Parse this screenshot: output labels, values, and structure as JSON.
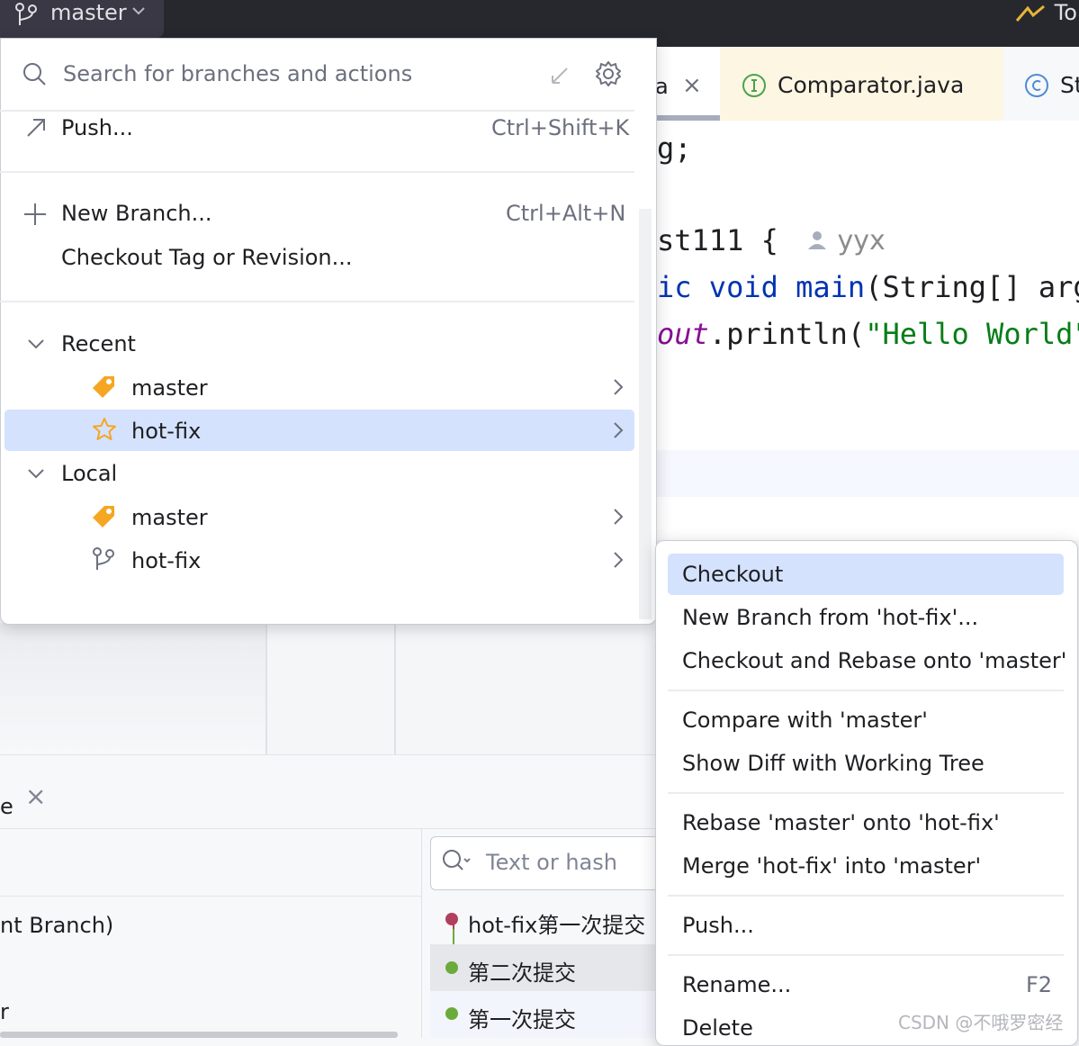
{
  "titlebar": {
    "branch_label": "master",
    "right_text": "To"
  },
  "editor_tabs": [
    {
      "label": "a",
      "close": "×"
    },
    {
      "label": "Comparator.java"
    },
    {
      "label": "St"
    }
  ],
  "code": {
    "line1": "g;",
    "line2": "st111 {",
    "author": "yyx",
    "line3_kw": "ic void ",
    "line3_fn": "main",
    "line3_rest": "(String[] arg",
    "line4_fld": "out",
    "line4_mid": ".println(",
    "line4_str": "\"Hello World\""
  },
  "branch_popup": {
    "search_placeholder": "Search for branches and actions",
    "actions": [
      {
        "label": "Push...",
        "shortcut": "Ctrl+Shift+K"
      },
      {
        "label": "New Branch...",
        "shortcut": "Ctrl+Alt+N"
      },
      {
        "label": "Checkout Tag or Revision..."
      }
    ],
    "groups": [
      {
        "label": "Recent",
        "branches": [
          "master",
          "hot-fix"
        ]
      },
      {
        "label": "Local",
        "branches": [
          "master",
          "hot-fix"
        ]
      }
    ]
  },
  "context_menu": {
    "items": [
      "Checkout",
      "New Branch from 'hot-fix'...",
      "Checkout and Rebase onto 'master'",
      "Compare with 'master'",
      "Show Diff with Working Tree",
      "Rebase 'master' onto 'hot-fix'",
      "Merge 'hot-fix' into 'master'",
      "Push...",
      "Rename...",
      "Delete"
    ],
    "rename_shortcut": "F2"
  },
  "lower_panel": {
    "tab_fragment": "e",
    "tab_close": "×",
    "branch_fragment": "nt Branch)",
    "r_fragment": "r",
    "search_placeholder": "Text or hash",
    "commits": [
      {
        "message": "hot-fix第一次提交",
        "color": "#b0405e"
      },
      {
        "message": "第二次提交",
        "color": "#6bab3c"
      },
      {
        "message": "第一次提交",
        "color": "#6bab3c"
      }
    ]
  },
  "watermark": "CSDN @不哦罗密经",
  "colors": {
    "highlight": "#d4e2fe",
    "tag": "#f5a623"
  }
}
